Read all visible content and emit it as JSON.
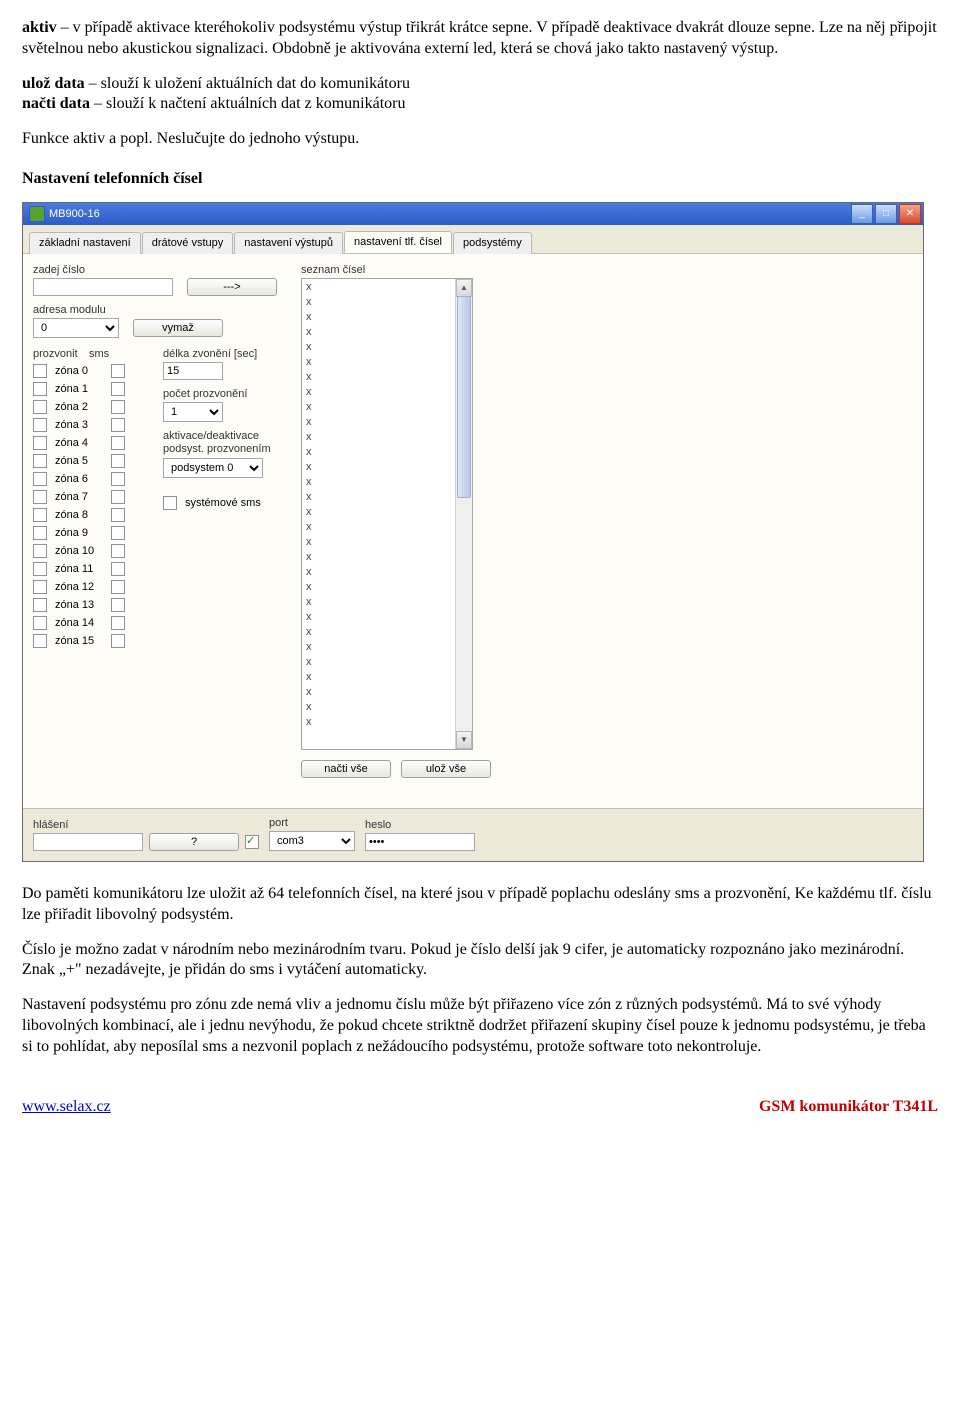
{
  "doc": {
    "p1a": "aktiv",
    "p1b": " – v případě aktivace kteréhokoliv podsystému výstup třikrát krátce sepne. V případě deaktivace dvakrát dlouze sepne. Lze na něj připojit světelnou nebo akustickou signalizaci. Obdobně je aktivována externí led, která se chová jako takto nastavený výstup.",
    "p2a": "ulož data",
    "p2b": " – slouží k uložení aktuálních dat do komunikátoru",
    "p3a": "načti data",
    "p3b": " – slouží k načtení aktuálních dat z komunikátoru",
    "p4": "Funkce aktiv a popl. Neslučujte do jednoho výstupu.",
    "heading": "Nastavení telefonních čísel",
    "p5": "Do paměti komunikátoru lze uložit až 64 telefonních čísel, na které jsou v případě poplachu odeslány sms a prozvonění, Ke každému tlf. číslu lze přiřadit libovolný podsystém.",
    "p6": "Číslo je možno zadat v národním nebo mezinárodním tvaru. Pokud je číslo delší jak 9 cifer, je automaticky rozpoznáno jako mezinárodní. Znak „+\" nezadávejte, je přidán do sms i vytáčení automaticky.",
    "p7": "Nastavení podsystému pro zónu zde nemá vliv a jednomu číslu může být přiřazeno více zón z různých podsystémů. Má to své výhody libovolných kombinací, ale i jednu nevýhodu, že pokud chcete striktně dodržet přiřazení skupiny čísel pouze k jednomu podsystému, je třeba si to pohlídat, aby neposílal sms a nezvonil poplach z nežádoucího podsystému, protože software toto nekontroluje.",
    "footer_left": "www.selax.cz",
    "footer_right": "GSM komunikátor T341L"
  },
  "app": {
    "title": "MB900-16",
    "tabs": [
      "základní nastavení",
      "drátové vstupy",
      "nastavení výstupů",
      "nastavení tlf. čísel",
      "podsystémy"
    ],
    "active_tab": 3,
    "labels": {
      "zadej_cislo": "zadej číslo",
      "adresa_modulu": "adresa modulu",
      "prozvonit": "prozvonit",
      "sms": "sms",
      "delka_zvoneni": "délka zvonění [sec]",
      "pocet_prozvoneni": "počet prozvonění",
      "aktivace": "aktivace/deaktivace podsyst. prozvonením",
      "systemove_sms": "systémové sms",
      "seznam_cisel": "seznam čísel",
      "hlaseni": "hlášení",
      "port": "port",
      "heslo": "heslo"
    },
    "buttons": {
      "add": "--->",
      "vymaz": "vymaž",
      "nacti_vse": "načti vše",
      "uloz_vse": "ulož vše",
      "help": "?"
    },
    "values": {
      "adresa_modulu": "0",
      "delka_zvoneni": "15",
      "pocet_prozvoneni": "1",
      "podsystem": "podsystem 0",
      "port": "com3",
      "heslo": "••••"
    },
    "zones": [
      "zóna 0",
      "zóna 1",
      "zóna 2",
      "zóna 3",
      "zóna 4",
      "zóna 5",
      "zóna 6",
      "zóna 7",
      "zóna 8",
      "zóna 9",
      "zóna 10",
      "zóna 11",
      "zóna 12",
      "zóna 13",
      "zóna 14",
      "zóna 15"
    ],
    "list_rows": 30
  }
}
